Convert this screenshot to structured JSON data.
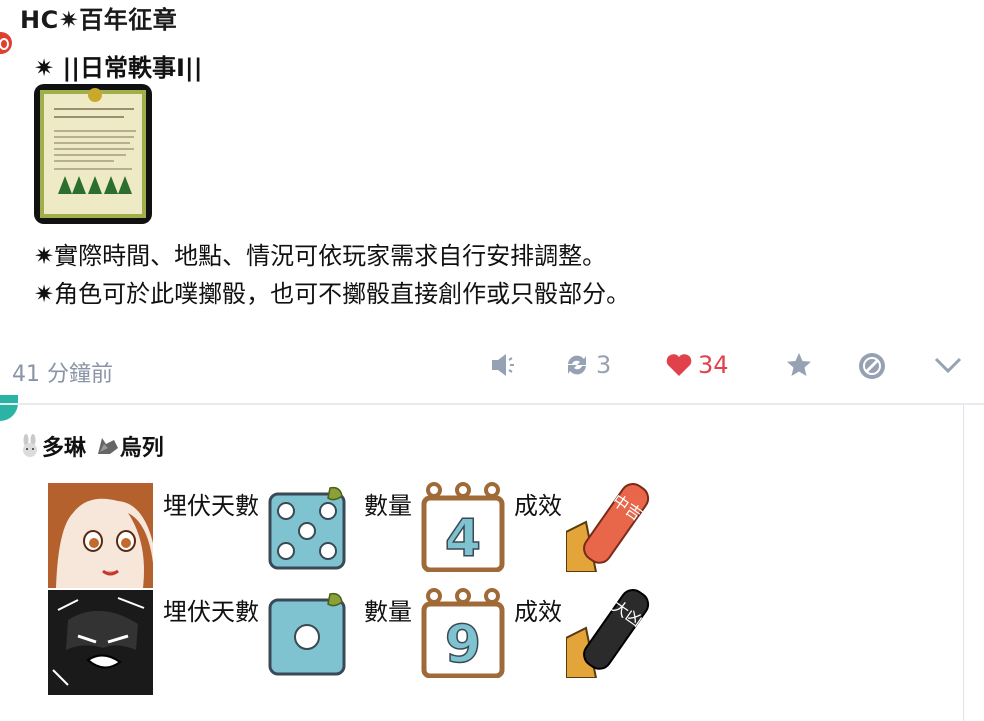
{
  "post1": {
    "author": "HC✷百年征章",
    "subtitle": "✷ ||日常軼事I||",
    "lines": [
      "✷實際時間、地點、情況可依玩家需求自行安排調整。",
      "✷角色可於此噗擲骰，也可不擲骰直接創作或只骰部分。"
    ],
    "time": "41 分鐘前",
    "replurk_count": "3",
    "like_count": "34"
  },
  "post2": {
    "names": "多琳",
    "names2": "烏列",
    "rows": [
      {
        "label1": "埋伏天數",
        "die_value": 5,
        "label2": "數量",
        "count_value": "4",
        "label3": "成效",
        "result": "中吉"
      },
      {
        "label1": "埋伏天數",
        "die_value": 1,
        "label2": "數量",
        "count_value": "9",
        "label3": "成效",
        "result": "大凶"
      }
    ]
  },
  "colors": {
    "accent_red": "#e0414a",
    "action_gray": "#97a1b4",
    "teal": "#2bb3a3",
    "dice_blue": "#7ec3cf"
  }
}
